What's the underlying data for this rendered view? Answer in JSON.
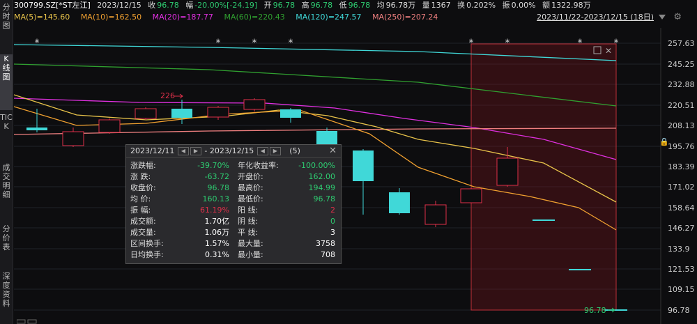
{
  "sidebar": {
    "tabs": [
      {
        "label": "分时图",
        "active": false
      },
      {
        "label": "K线图",
        "active": true
      },
      {
        "label": "TICK",
        "active": false
      },
      {
        "label": "成交明细",
        "active": false
      },
      {
        "label": "分价表",
        "active": false
      },
      {
        "label": "深度资料",
        "active": false
      }
    ]
  },
  "header": {
    "symbol": "300799.SZ[*ST左江]",
    "date": "2023/12/15",
    "close_label": "收",
    "close_value": "96.78",
    "change_label": "幅",
    "change_value": "-20.00%[-24.19]",
    "open_label": "开",
    "open_value": "96.78",
    "high_label": "高",
    "high_value": "96.78",
    "low_label": "低",
    "low_value": "96.78",
    "avg_label": "均",
    "avg_value": "96.78万",
    "volume_label": "量",
    "volume_value": "1367",
    "turnover_label": "换",
    "turnover_value": "0.202%",
    "amp_label": "振",
    "amp_value": "0.00%",
    "amount_label": "额",
    "amount_value": "1322.98万"
  },
  "ma_bar": {
    "items": [
      {
        "label": "MA(5)=145.60",
        "color": "#e8c34a"
      },
      {
        "label": "MA(10)=162.50",
        "color": "#f0a030"
      },
      {
        "label": "MA(20)=187.77",
        "color": "#e030e0"
      },
      {
        "label": "MA(60)=220.43",
        "color": "#30a030"
      },
      {
        "label": "MA(120)=247.57",
        "color": "#40d8d8"
      },
      {
        "label": "MA(250)=207.24",
        "color": "#f08080"
      }
    ],
    "range_label": "2023/11/22-2023/12/15 (18日)"
  },
  "price_axis": {
    "ticks": [
      "257.63",
      "245.25",
      "232.88",
      "220.51",
      "208.13",
      "195.76",
      "183.39",
      "171.02",
      "158.64",
      "146.27",
      "133.9",
      "121.53",
      "109.15",
      "96.78"
    ]
  },
  "chart": {
    "annotation_high": "226",
    "annotation_last": "96.78"
  },
  "popup": {
    "date_from": "2023/12/11",
    "date_to": "2023/12/15",
    "count": "(5)",
    "rows": [
      {
        "l1": "涨跌幅:",
        "v1": "-39.70%",
        "c1": "#2ecc71",
        "l2": "年化收益率:",
        "v2": "-100.00%",
        "c2": "#2ecc71"
      },
      {
        "l1": "涨    跌:",
        "v1": "-63.72",
        "c1": "#2ecc71",
        "l2": "开盘价:",
        "v2": "162.00",
        "c2": "#2ecc71"
      },
      {
        "l1": "收盘价:",
        "v1": "96.78",
        "c1": "#2ecc71",
        "l2": "最高价:",
        "v2": "194.99",
        "c2": "#2ecc71"
      },
      {
        "l1": "均    价:",
        "v1": "160.13",
        "c1": "#2ecc71",
        "l2": "最低价:",
        "v2": "96.78",
        "c2": "#2ecc71"
      },
      {
        "l1": "振    幅:",
        "v1": "61.19%",
        "c1": "#e0304a",
        "l2": "阳    线:",
        "v2": "2",
        "c2": "#e0304a"
      },
      {
        "l1": "成交额:",
        "v1": "1.70亿",
        "c1": "#ffffff",
        "l2": "阴    线:",
        "v2": "0",
        "c2": "#2ecc71"
      },
      {
        "l1": "成交量:",
        "v1": "1.06万",
        "c1": "#ffffff",
        "l2": "平    线:",
        "v2": "3",
        "c2": "#ffffff"
      },
      {
        "l1": "区间换手:",
        "v1": "1.57%",
        "c1": "#ffffff",
        "l2": "最大量:",
        "v2": "3758",
        "c2": "#ffffff"
      },
      {
        "l1": "日均换手:",
        "v1": "0.31%",
        "c1": "#ffffff",
        "l2": "最小量:",
        "v2": "708",
        "c2": "#ffffff"
      }
    ]
  },
  "colors": {
    "up": "#e0304a",
    "down": "#40d8d8",
    "background": "#0d0d0f"
  }
}
